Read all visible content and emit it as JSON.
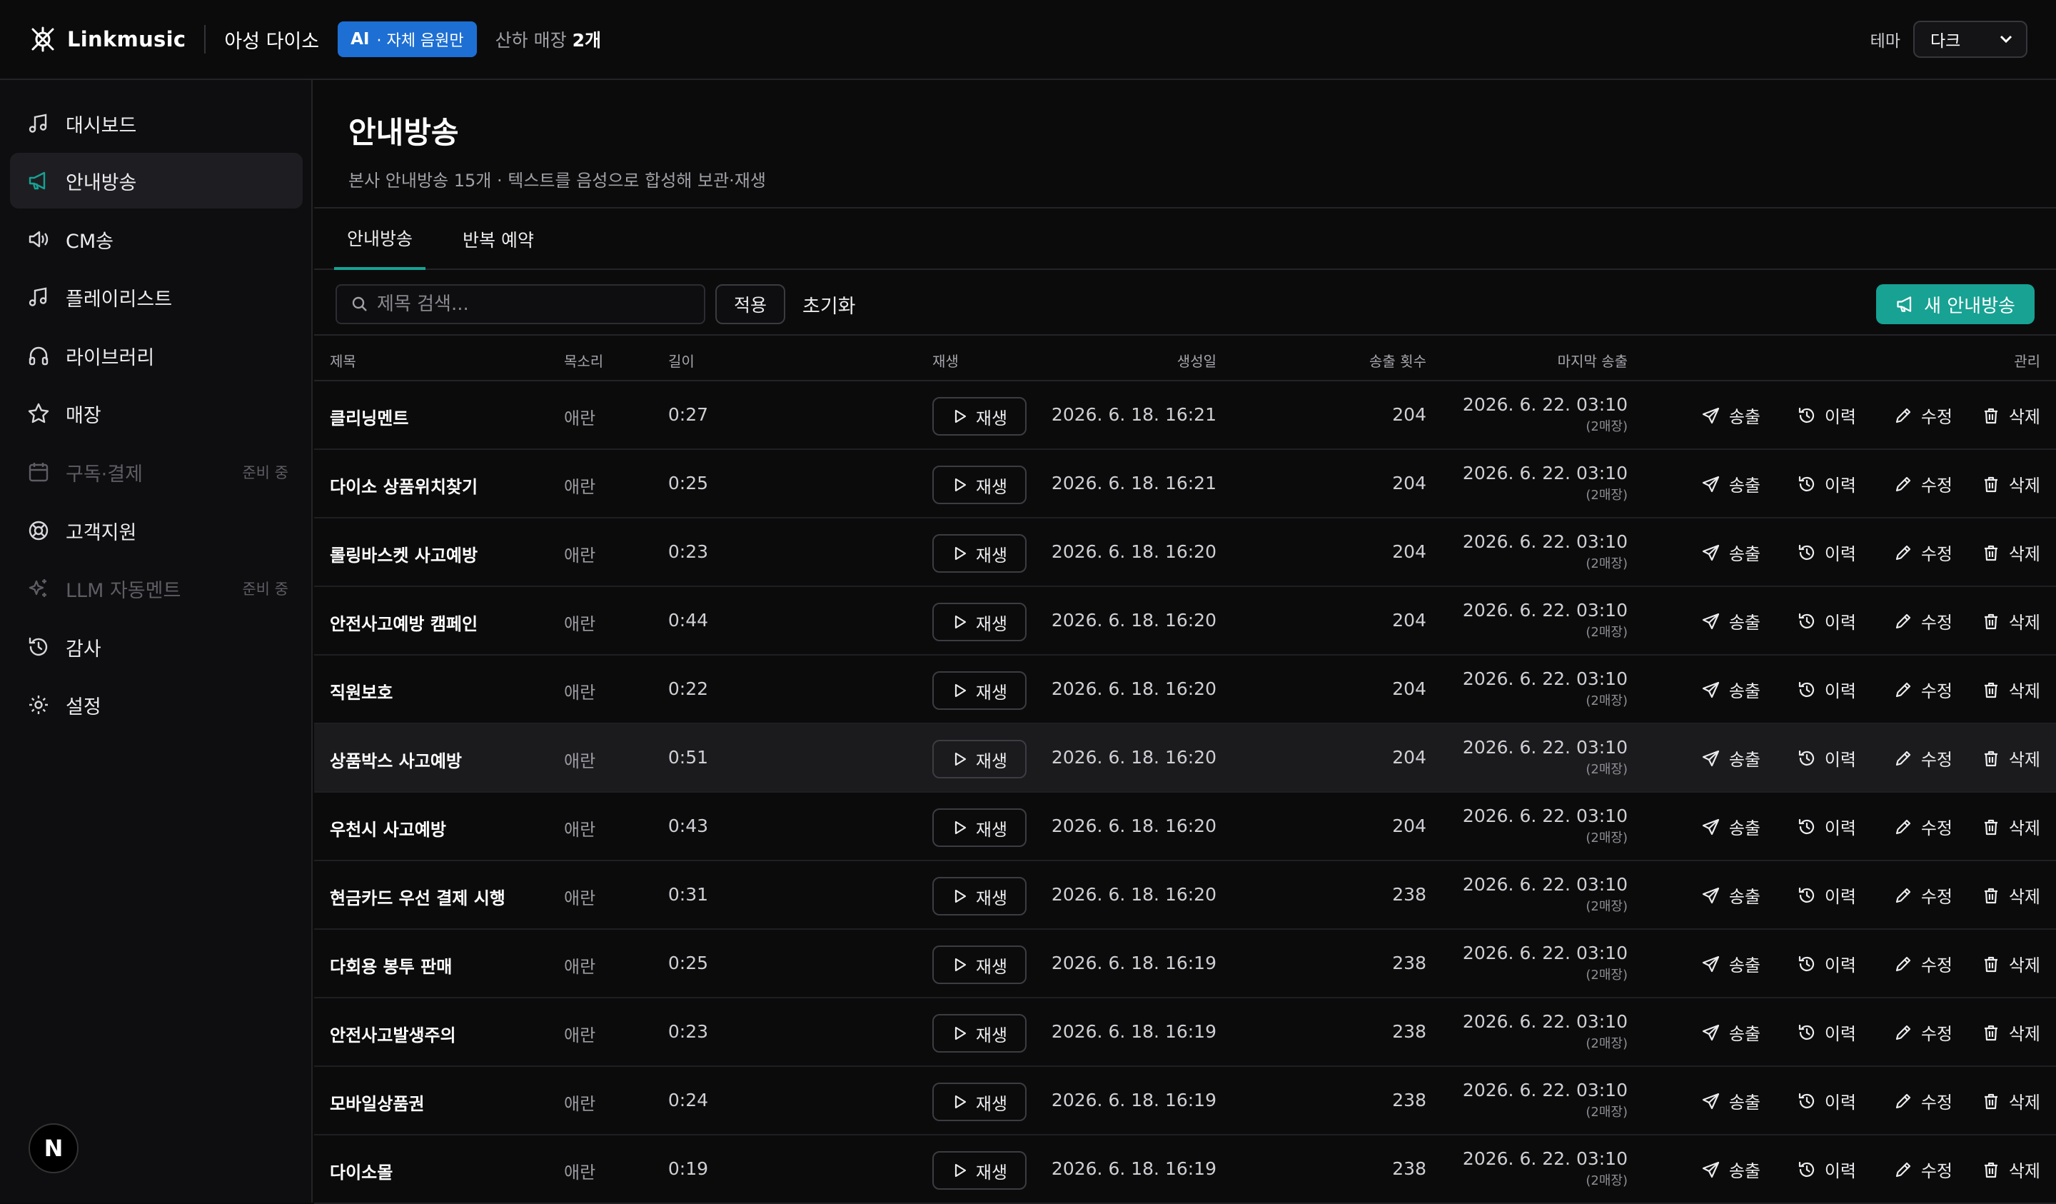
{
  "app": {
    "name": "Linkmusic",
    "store": "아성 다이소",
    "ai_badge": "AI",
    "ai_badge_text": "· 자체 음원만",
    "sub_stores_label": "산하 매장",
    "sub_stores_count": "2개",
    "theme_label": "테마",
    "theme_value": "다크",
    "avatar_letter": "N",
    "accent": "#17a293"
  },
  "sidebar": {
    "items": [
      {
        "label": "대시보드",
        "icon": "music-note-icon"
      },
      {
        "label": "안내방송",
        "icon": "megaphone-icon",
        "active": true
      },
      {
        "label": "CM송",
        "icon": "speaker-icon"
      },
      {
        "label": "플레이리스트",
        "icon": "music-note-icon"
      },
      {
        "label": "라이브러리",
        "icon": "headphones-icon"
      },
      {
        "label": "매장",
        "icon": "star-icon"
      },
      {
        "label": "구독·결제",
        "icon": "calendar-icon",
        "disabled": true,
        "badge": "준비 중"
      },
      {
        "label": "고객지원",
        "icon": "lifebuoy-icon"
      },
      {
        "label": "LLM 자동멘트",
        "icon": "sparkle-icon",
        "disabled": true,
        "badge": "준비 중"
      },
      {
        "label": "감사",
        "icon": "history-icon"
      },
      {
        "label": "설정",
        "icon": "gear-icon"
      }
    ]
  },
  "page": {
    "title": "안내방송",
    "description": "본사 안내방송 15개 · 텍스트를 음성으로 합성해 보관·재생"
  },
  "tabs": [
    "안내방송",
    "반복 예약"
  ],
  "toolbar": {
    "search_placeholder": "제목 검색...",
    "apply": "적용",
    "reset": "초기화",
    "new": "새 안내방송"
  },
  "table": {
    "headers": {
      "title": "제목",
      "voice": "목소리",
      "length": "길이",
      "created": "생성일",
      "play": "재생",
      "count": "송출 횟수",
      "last": "마지막 송출",
      "manage": "관리"
    },
    "play_label": "재생",
    "actions": [
      "송출",
      "이력",
      "수정",
      "삭제"
    ],
    "rows": [
      {
        "title": "클리닝멘트",
        "voice": "애란",
        "length": "0:27",
        "created": "2026. 6. 18. 16:21",
        "count": "204",
        "last": "2026. 6. 22. 03:10",
        "last_sub": "(2매장)"
      },
      {
        "title": "다이소 상품위치찾기",
        "voice": "애란",
        "length": "0:25",
        "created": "2026. 6. 18. 16:21",
        "count": "204",
        "last": "2026. 6. 22. 03:10",
        "last_sub": "(2매장)"
      },
      {
        "title": "롤링바스켓 사고예방",
        "voice": "애란",
        "length": "0:23",
        "created": "2026. 6. 18. 16:20",
        "count": "204",
        "last": "2026. 6. 22. 03:10",
        "last_sub": "(2매장)"
      },
      {
        "title": "안전사고예방 캠페인",
        "voice": "애란",
        "length": "0:44",
        "created": "2026. 6. 18. 16:20",
        "count": "204",
        "last": "2026. 6. 22. 03:10",
        "last_sub": "(2매장)"
      },
      {
        "title": "직원보호",
        "voice": "애란",
        "length": "0:22",
        "created": "2026. 6. 18. 16:20",
        "count": "204",
        "last": "2026. 6. 22. 03:10",
        "last_sub": "(2매장)"
      },
      {
        "title": "상품박스 사고예방",
        "voice": "애란",
        "length": "0:51",
        "created": "2026. 6. 18. 16:20",
        "count": "204",
        "last": "2026. 6. 22. 03:10",
        "last_sub": "(2매장)",
        "highlight": true
      },
      {
        "title": "우천시 사고예방",
        "voice": "애란",
        "length": "0:43",
        "created": "2026. 6. 18. 16:20",
        "count": "204",
        "last": "2026. 6. 22. 03:10",
        "last_sub": "(2매장)"
      },
      {
        "title": "현금카드 우선 결제 시행",
        "voice": "애란",
        "length": "0:31",
        "created": "2026. 6. 18. 16:20",
        "count": "238",
        "last": "2026. 6. 22. 03:10",
        "last_sub": "(2매장)"
      },
      {
        "title": "다회용 봉투 판매",
        "voice": "애란",
        "length": "0:25",
        "created": "2026. 6. 18. 16:19",
        "count": "238",
        "last": "2026. 6. 22. 03:10",
        "last_sub": "(2매장)"
      },
      {
        "title": "안전사고발생주의",
        "voice": "애란",
        "length": "0:23",
        "created": "2026. 6. 18. 16:19",
        "count": "238",
        "last": "2026. 6. 22. 03:10",
        "last_sub": "(2매장)"
      },
      {
        "title": "모바일상품권",
        "voice": "애란",
        "length": "0:24",
        "created": "2026. 6. 18. 16:19",
        "count": "238",
        "last": "2026. 6. 22. 03:10",
        "last_sub": "(2매장)"
      },
      {
        "title": "다이소몰",
        "voice": "애란",
        "length": "0:19",
        "created": "2026. 6. 18. 16:19",
        "count": "238",
        "last": "2026. 6. 22. 03:10",
        "last_sub": "(2매장)"
      }
    ]
  }
}
